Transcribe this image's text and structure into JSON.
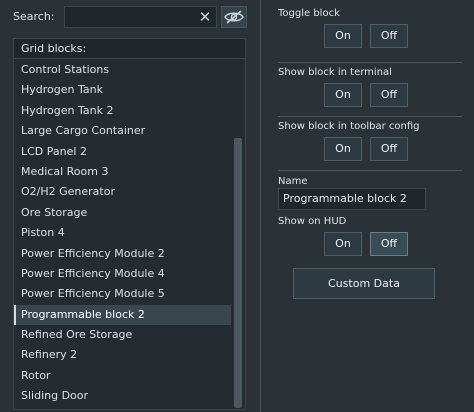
{
  "search": {
    "label": "Search:",
    "value": "",
    "clear_glyph": "✕",
    "visibility_icon": "eye-crossed-icon"
  },
  "list": {
    "header": "Grid blocks:",
    "items": [
      "Control Stations",
      "Hydrogen Tank",
      "Hydrogen Tank 2",
      "Large Cargo Container",
      "LCD Panel 2",
      "Medical Room 3",
      "O2/H2 Generator",
      "Ore Storage",
      "Piston 4",
      "Power Efficiency Module 2",
      "Power Efficiency Module 4",
      "Power Efficiency Module 5",
      "Programmable block 2",
      "Refined Ore Storage",
      "Refinery 2",
      "Rotor",
      "Sliding Door"
    ],
    "selected": "Programmable block 2"
  },
  "toggle_block": {
    "label": "Toggle block",
    "on": "On",
    "off": "Off"
  },
  "show_terminal": {
    "label": "Show block in terminal",
    "on": "On",
    "off": "Off"
  },
  "show_toolbar": {
    "label": "Show block in toolbar config",
    "on": "On",
    "off": "Off"
  },
  "name": {
    "label": "Name",
    "value": "Programmable block 2"
  },
  "show_hud": {
    "label": "Show on HUD",
    "on": "On",
    "off": "Off"
  },
  "custom_data": {
    "label": "Custom Data"
  }
}
